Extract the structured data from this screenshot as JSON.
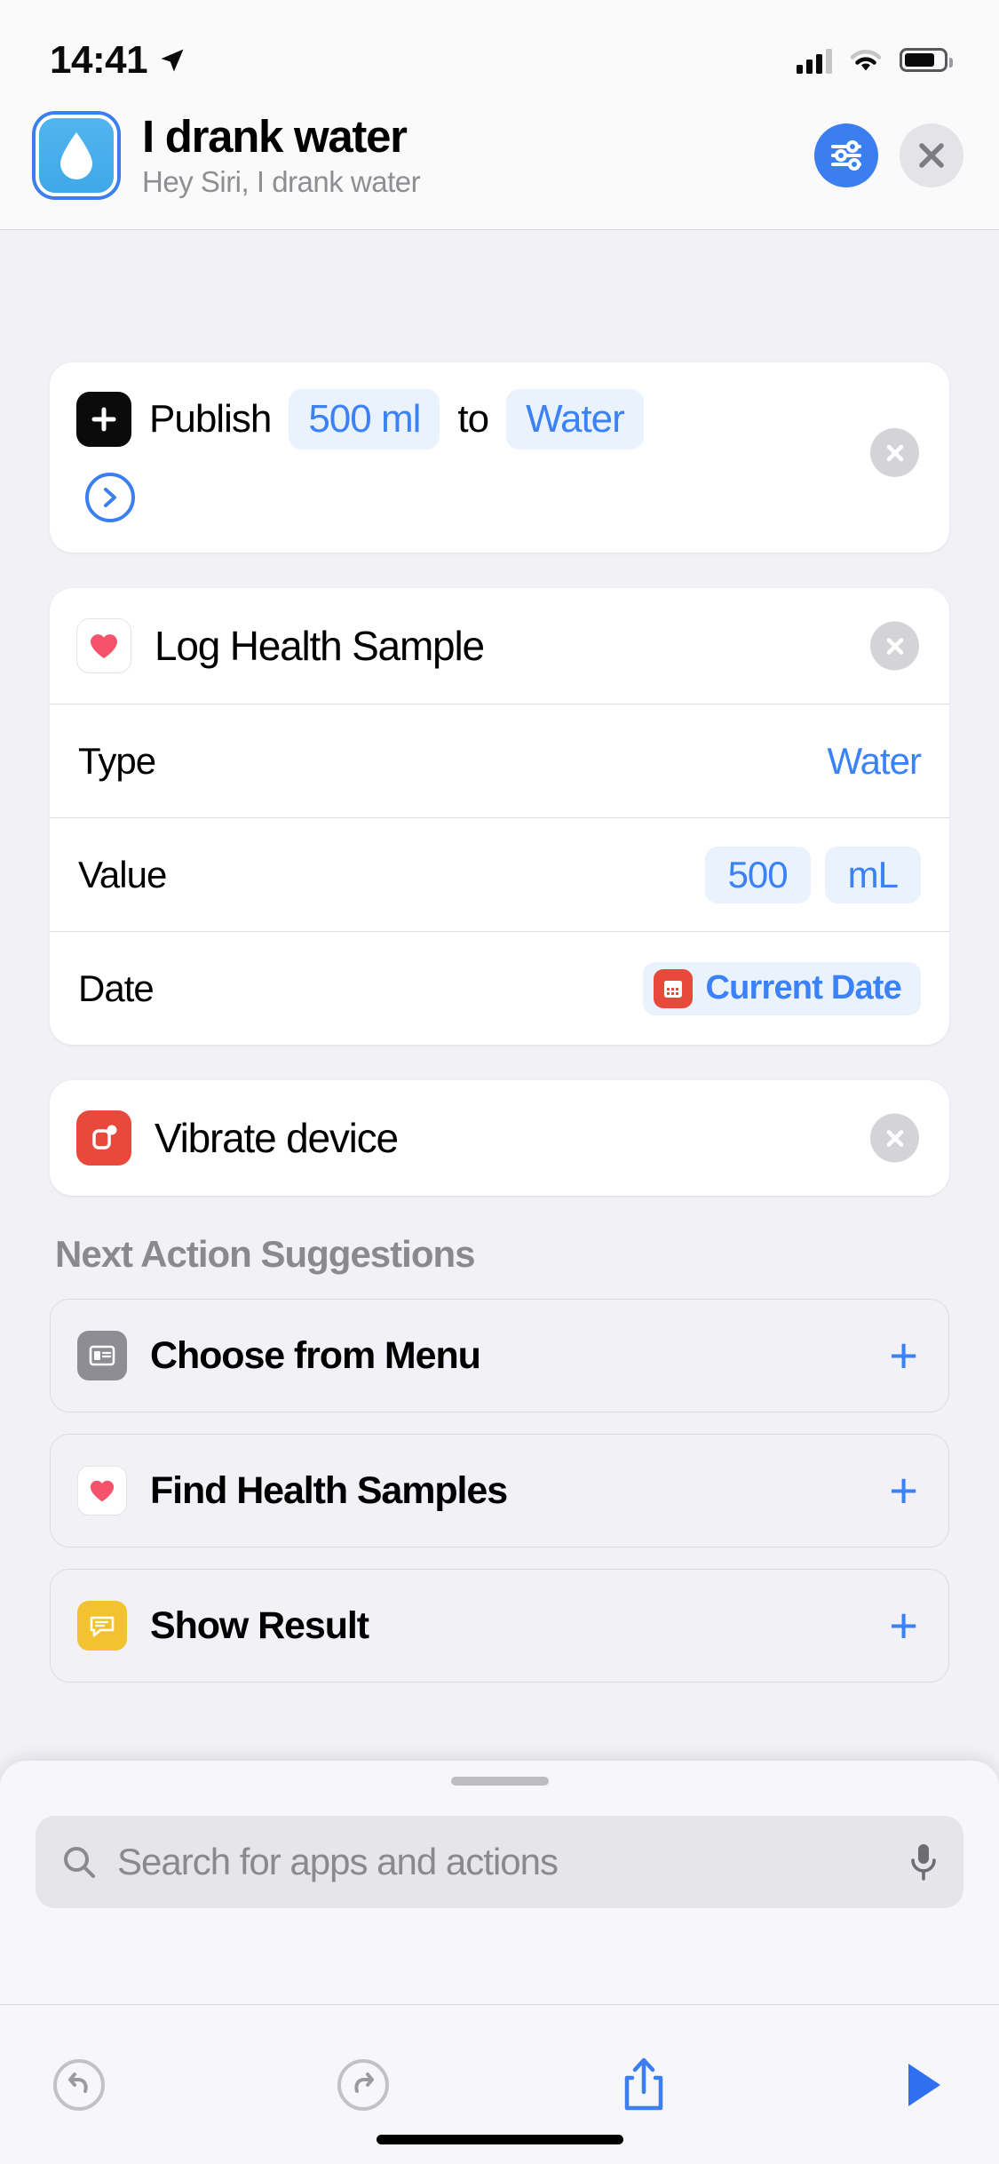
{
  "status_bar": {
    "time": "14:41",
    "location_icon": "location-arrow-icon",
    "signal_icon": "cellular-signal-icon",
    "wifi_icon": "wifi-icon",
    "battery_icon": "battery-icon"
  },
  "header": {
    "app_icon": "water-drop-icon",
    "title": "I drank water",
    "subtitle": "Hey Siri, I drank water",
    "settings_button": "settings-sliders-icon",
    "close_button": "close-icon",
    "accent_color": "#3b7ef0"
  },
  "actions": [
    {
      "id": "publish",
      "icon": "plus-square-icon",
      "icon_color": "#0b0b0c",
      "segments": [
        {
          "type": "text",
          "text": "Publish"
        },
        {
          "type": "token",
          "text": "500 ml"
        },
        {
          "type": "text",
          "text": "to"
        },
        {
          "type": "token",
          "text": "Water"
        }
      ],
      "disclosure": "chevron-right-icon",
      "remove": "remove-icon"
    },
    {
      "id": "log-health-sample",
      "icon": "heart-icon",
      "icon_color": "#ff2d55",
      "title": "Log Health Sample",
      "remove": "remove-icon",
      "rows": [
        {
          "label": "Type",
          "value_kind": "plain",
          "value": "Water"
        },
        {
          "label": "Value",
          "value_kind": "pills",
          "values": [
            "500",
            "mL"
          ]
        },
        {
          "label": "Date",
          "value_kind": "icon_pill",
          "value": "Current Date",
          "value_icon": "calendar-icon",
          "value_icon_color": "#e8493a"
        }
      ]
    },
    {
      "id": "vibrate-device",
      "icon": "vibrate-icon",
      "icon_color": "#e8493a",
      "title": "Vibrate device",
      "remove": "remove-icon"
    }
  ],
  "suggestions": {
    "heading": "Next Action Suggestions",
    "items": [
      {
        "icon": "menu-list-icon",
        "icon_color": "#8d8d93",
        "label": "Choose from Menu",
        "add": "add-icon"
      },
      {
        "icon": "heart-icon",
        "icon_color": "#ff2d55",
        "label": "Find Health Samples",
        "add": "add-icon"
      },
      {
        "icon": "show-result-icon",
        "icon_color": "#f2c230",
        "label": "Show Result",
        "add": "add-icon"
      }
    ]
  },
  "sheet": {
    "grabber": "drag-handle",
    "search": {
      "icon": "search-icon",
      "placeholder": "Search for apps and actions",
      "mic_icon": "microphone-icon"
    },
    "toolbar": {
      "undo": "undo-icon",
      "redo": "redo-icon",
      "share": "share-icon",
      "play": "play-icon"
    }
  }
}
